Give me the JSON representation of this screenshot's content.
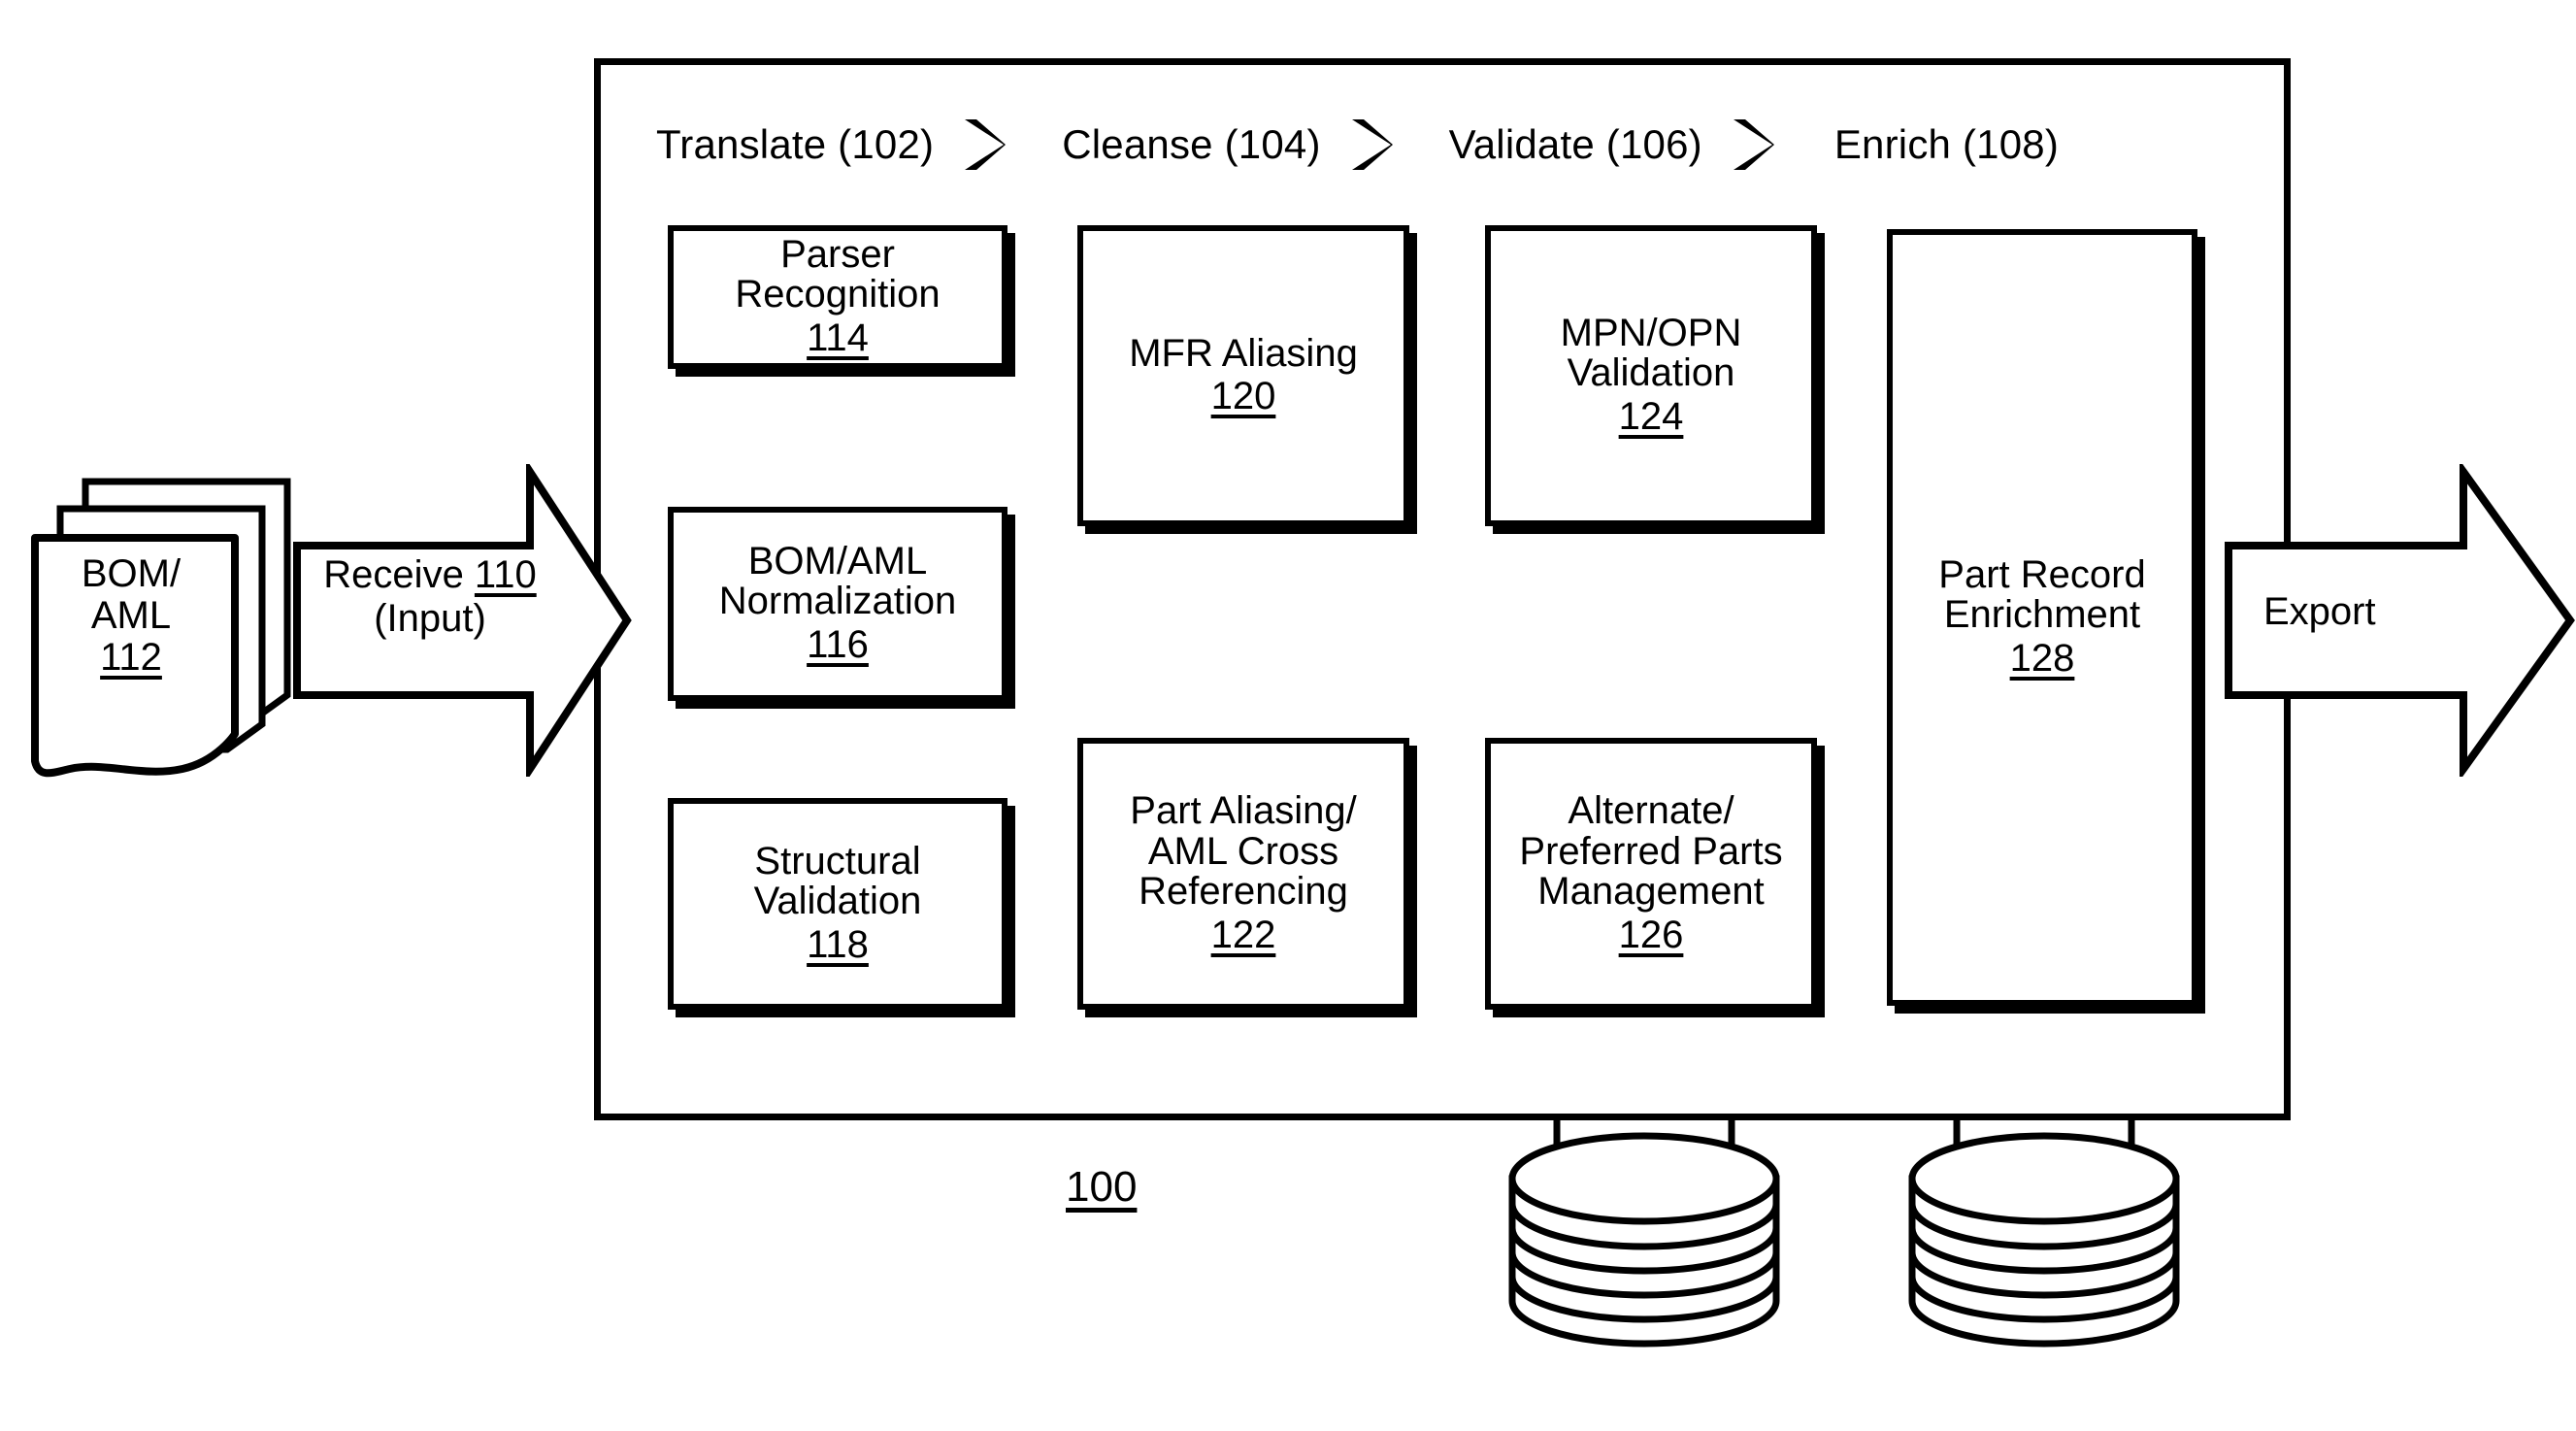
{
  "figure": {
    "number": "100"
  },
  "phases": [
    {
      "label": "Translate (102)"
    },
    {
      "label": "Cleanse (104)"
    },
    {
      "label": "Validate (106)"
    },
    {
      "label": "Enrich (108)"
    }
  ],
  "chevron_icon": "double-chevron-right",
  "input": {
    "icon": "document-stack-icon",
    "title": "BOM/\nAML",
    "number": "112"
  },
  "receive_arrow": {
    "icon": "block-arrow-right",
    "line1": "Receive ",
    "number": "110",
    "line2": "(Input)"
  },
  "export_arrow": {
    "icon": "block-arrow-right",
    "label": "Export"
  },
  "boxes": {
    "parser_recognition": {
      "text": "Parser\nRecognition",
      "number": "114"
    },
    "bom_aml_normalization": {
      "text": "BOM/AML\nNormalization",
      "number": "116"
    },
    "structural_validation": {
      "text": "Structural\nValidation",
      "number": "118"
    },
    "mfr_aliasing": {
      "text": "MFR Aliasing",
      "number": "120"
    },
    "part_aliasing": {
      "text": "Part Aliasing/\nAML Cross\nReferencing",
      "number": "122"
    },
    "mpn_opn_validation": {
      "text": "MPN/OPN\nValidation",
      "number": "124"
    },
    "alternate_preferred_parts": {
      "text": "Alternate/\nPreferred Parts\nManagement",
      "number": "126"
    },
    "part_record_enrichment": {
      "text": "Part Record\nEnrichment",
      "number": "128"
    }
  },
  "databases": [
    {
      "icon": "database-disk-stack-icon"
    },
    {
      "icon": "database-disk-stack-icon"
    }
  ],
  "colors": {
    "stroke": "#000000",
    "background": "#ffffff"
  }
}
